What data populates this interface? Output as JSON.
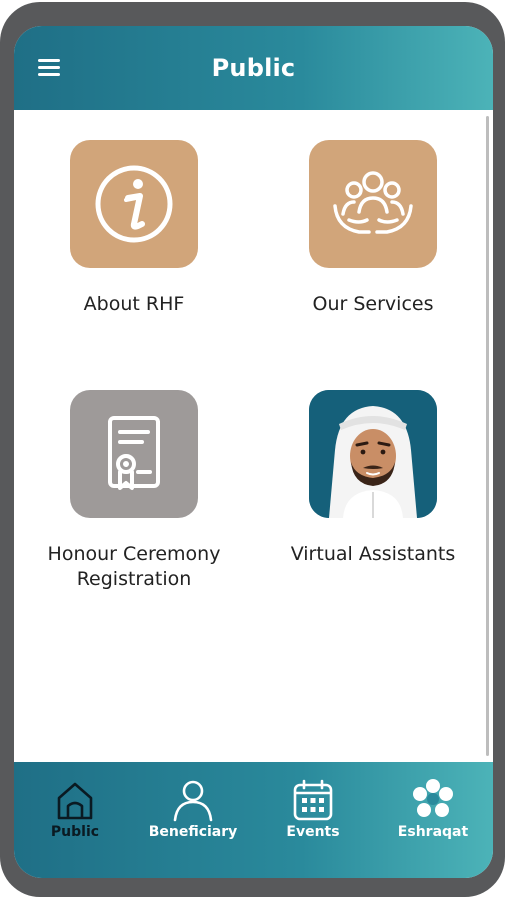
{
  "header": {
    "title": "Public",
    "menu_icon": "hamburger-menu-icon"
  },
  "tiles": [
    {
      "label": "About RHF",
      "icon": "info-icon",
      "color": "#d1a57a"
    },
    {
      "label": "Our Services",
      "icon": "people-in-hands-icon",
      "color": "#d1a57a"
    },
    {
      "label": "Honour Ceremony Registration",
      "icon": "certificate-icon",
      "color": "#9e9a99"
    },
    {
      "label": "Virtual Assistants",
      "icon": "assistant-avatar-icon",
      "color": "#15607a"
    }
  ],
  "tabs": [
    {
      "label": "Public",
      "icon": "home-icon",
      "active": true
    },
    {
      "label": "Beneficiary",
      "icon": "person-icon",
      "active": false
    },
    {
      "label": "Events",
      "icon": "calendar-icon",
      "active": false
    },
    {
      "label": "Eshraqat",
      "icon": "flower-icon",
      "active": false
    }
  ],
  "colors": {
    "header_start": "#1f6f86",
    "header_end": "#4cb3b8",
    "tile_tan": "#d1a57a",
    "tile_grey": "#9e9a99",
    "device_frame": "#58595b"
  }
}
